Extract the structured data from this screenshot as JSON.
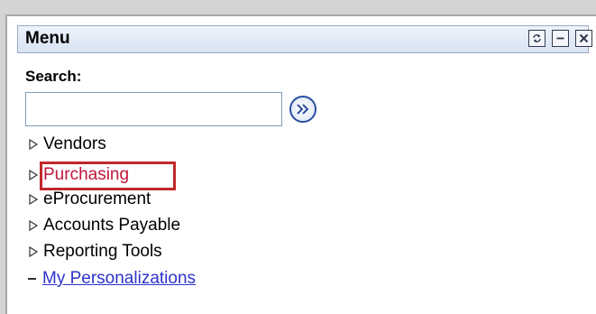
{
  "panel": {
    "title": "Menu",
    "buttons": {
      "refresh_icon": "refresh-icon",
      "minimize_icon": "minimize-icon",
      "close_icon": "close-icon"
    }
  },
  "search": {
    "label": "Search:",
    "value": "",
    "placeholder": "",
    "go_icon": "double-chevron-right-icon"
  },
  "menu": {
    "items": [
      {
        "label": "Vendors",
        "icon": "triangle-right-icon"
      },
      {
        "label": "Purchasing",
        "icon": "triangle-right-icon"
      },
      {
        "label": "eProcurement",
        "icon": "triangle-right-icon"
      },
      {
        "label": "Accounts Payable",
        "icon": "triangle-right-icon"
      },
      {
        "label": "Reporting Tools",
        "icon": "triangle-right-icon"
      }
    ],
    "personalizations_link": "My Personalizations"
  },
  "colors": {
    "header_bg": "#d8e3f3",
    "highlight": "#c0282c",
    "link": "#2c33c9",
    "selected_text": "#c0163a"
  }
}
